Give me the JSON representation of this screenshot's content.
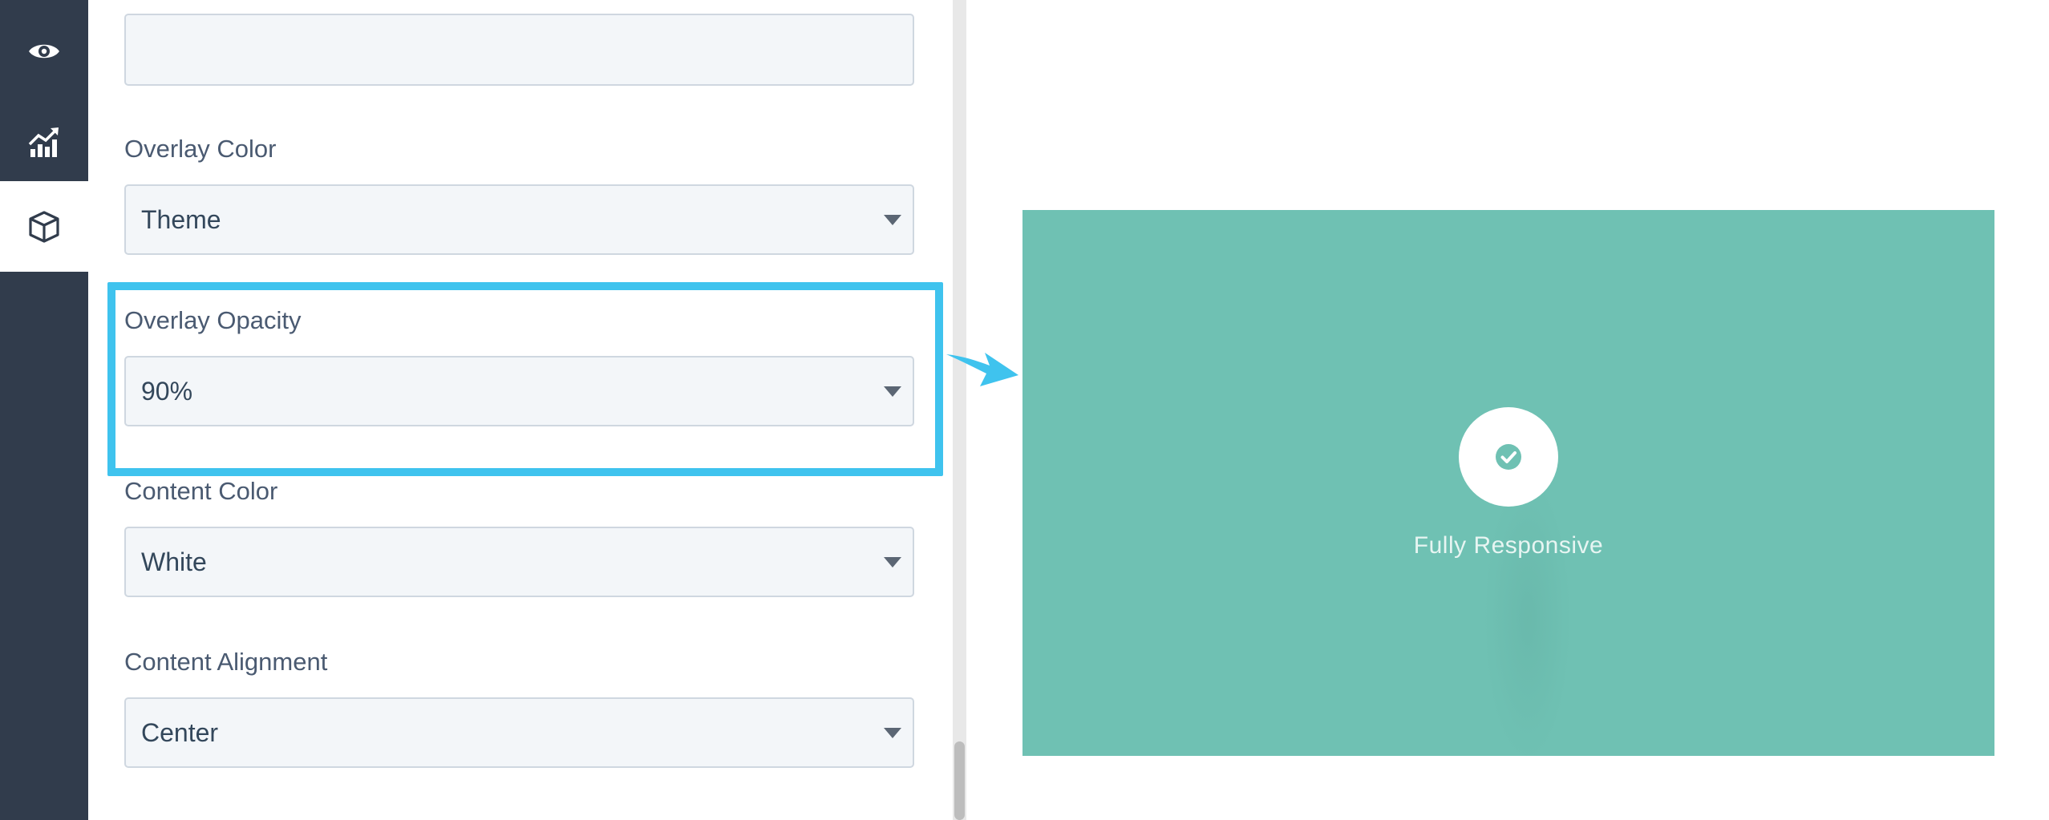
{
  "nav": {
    "items": [
      {
        "icon": "eye-icon",
        "active": false
      },
      {
        "icon": "chart-icon",
        "active": false
      },
      {
        "icon": "cube-icon",
        "active": true
      }
    ]
  },
  "panel": {
    "top_input_value": "",
    "fields": [
      {
        "label": "Overlay Color",
        "value": "Theme"
      },
      {
        "label": "Overlay Opacity",
        "value": "90%"
      },
      {
        "label": "Content Color",
        "value": "White"
      },
      {
        "label": "Content Alignment",
        "value": "Center"
      }
    ]
  },
  "preview": {
    "text": "Fully Responsive",
    "overlay_color": "#6fc1b3",
    "icon": "check-circle-icon"
  },
  "colors": {
    "highlight": "#3fc3ee",
    "nav_bg": "#313c4c"
  }
}
